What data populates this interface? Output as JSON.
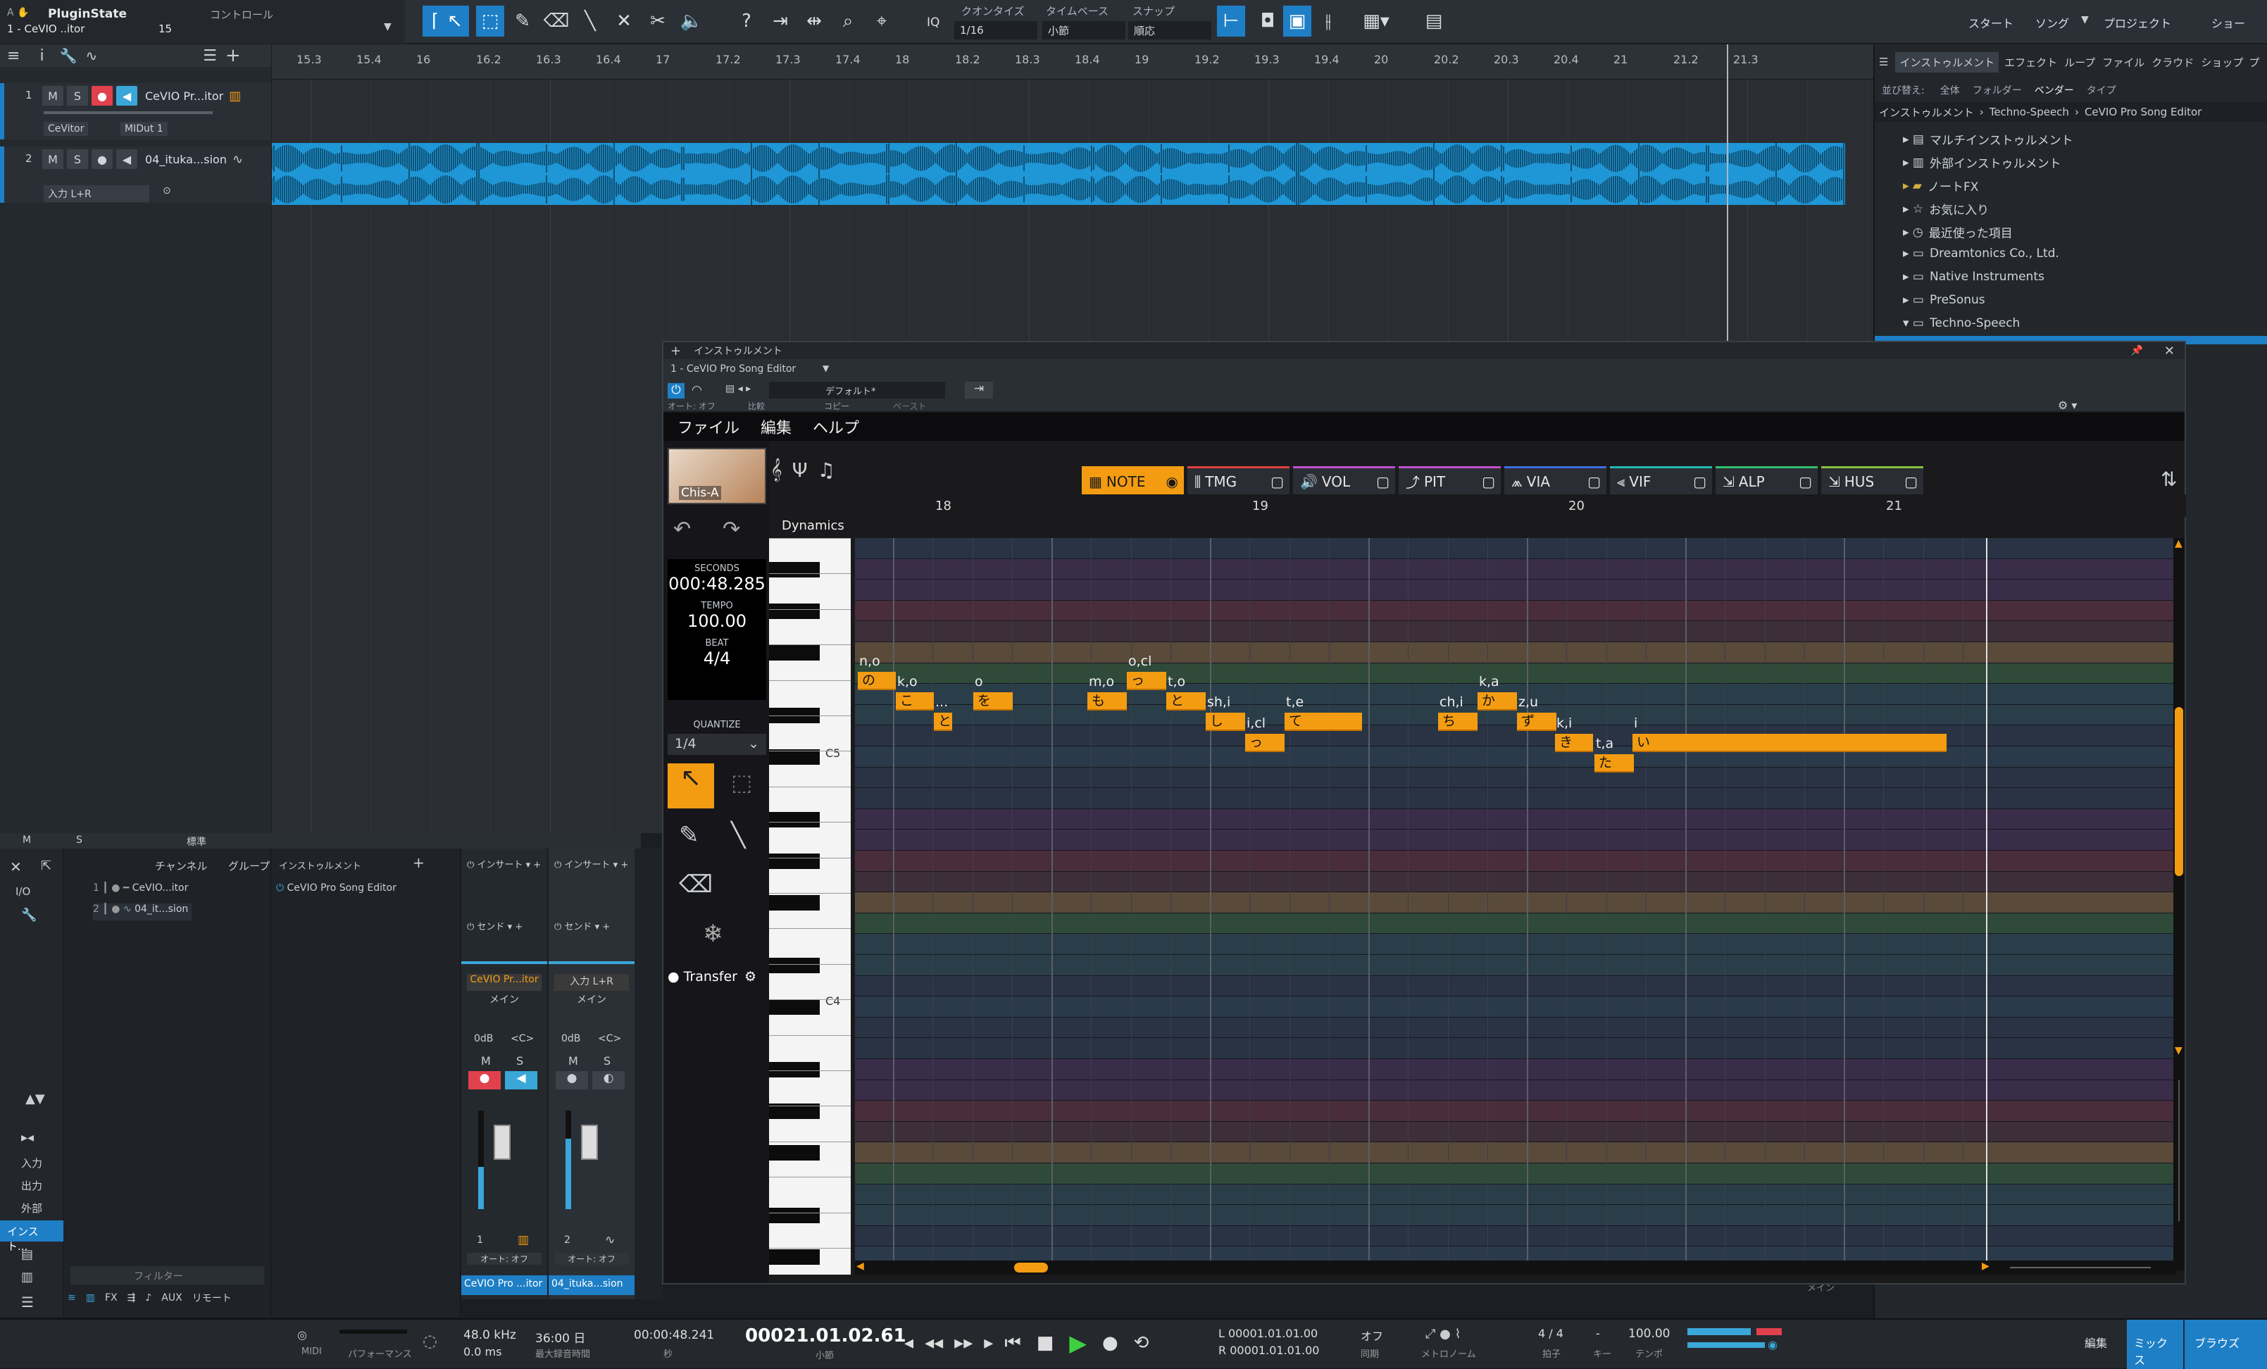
{
  "song": {
    "preset_top": "PluginState",
    "preset_bottom": "1 - CeVIO ..itor",
    "preset_num": "15",
    "control_label": "コントロール"
  },
  "toolbar": {
    "quantize_label": "クオンタイズ",
    "quantize_value": "1/16",
    "timebase_label": "タイムベース",
    "timebase_value": "小節",
    "snap_label": "スナップ",
    "snap_value": "順応",
    "iq": "IQ",
    "start": "スタート",
    "song": "ソング",
    "project": "プロジェクト",
    "show": "ショー"
  },
  "tracks": [
    {
      "num": "1",
      "name": "CeVIO Pr...itor",
      "in": "CeVitor",
      "out": "MIDut 1"
    },
    {
      "num": "2",
      "name": "04_ituka...sion",
      "in": "入力 L+R"
    }
  ],
  "ruler": [
    "15.3",
    "15.4",
    "16",
    "16.2",
    "16.3",
    "16.4",
    "17",
    "17.2",
    "17.3",
    "17.4",
    "18",
    "18.2",
    "18.3",
    "18.4",
    "19",
    "19.2",
    "19.3",
    "19.4",
    "20",
    "20.2",
    "20.3",
    "20.4",
    "21",
    "21.2",
    "21.3"
  ],
  "browser": {
    "tabs": [
      "インストゥルメント",
      "エフェクト",
      "ループ",
      "ファイル",
      "クラウド",
      "ショップ",
      "プ"
    ],
    "sort_label": "並び替え:",
    "sort_opts": [
      "全体",
      "フォルダー",
      "ベンダー",
      "タイプ"
    ],
    "breadcrumb": [
      "インストゥルメント",
      "Techno-Speech",
      "CeVIO Pro Song Editor"
    ],
    "items": [
      "マルチインストゥルメント",
      "外部インストゥルメント",
      "ノートFX",
      "お気に入り",
      "最近使った項目",
      "Dreamtonics Co., Ltd.",
      "Native Instruments",
      "PreSonus",
      "Techno-Speech"
    ]
  },
  "console": {
    "M": "M",
    "S": "S",
    "std": "標準",
    "channel": "チャンネル",
    "group": "グループ",
    "instrument": "インストゥルメント",
    "ch1": "CeVIO...itor",
    "ch2": "04_it...sion",
    "inst1": "CeVIO Pro Song Editor",
    "io": "I/O",
    "insert": "インサート",
    "send": "センド",
    "strip1_name": "CeVIO Pr...itor",
    "strip1_out": "メイン",
    "strip2_name": "入力 L+R",
    "strip2_out": "メイン",
    "db": "0dB",
    "pan": "<C>",
    "auto": "オート: オフ",
    "strip1_label": "CeVIO Pro ...itor",
    "strip2_label": "04_ituka...sion",
    "num1": "1",
    "num2": "2",
    "side": [
      "入力",
      "出力",
      "外部",
      "インスト..."
    ],
    "filter": "フィルター",
    "aux": "AUX",
    "remote": "リモート",
    "fx": "FX",
    "main": "メイン",
    "scale": [
      "10",
      "6",
      "0",
      "-6",
      "-12",
      "-18",
      "-24",
      "-30",
      "-48"
    ]
  },
  "editor": {
    "title": "インストゥルメント",
    "instance": "1 - CeVIO Pro Song Editor",
    "preset": "デフォルト*",
    "auto": "オート: オフ",
    "compare": "比較",
    "copy": "コピー",
    "paste": "ペースト",
    "menu": [
      "ファイル",
      "編集",
      "ヘルプ"
    ],
    "avatar": "Chis-A",
    "tabs": [
      "NOTE",
      "TMG",
      "VOL",
      "PIT",
      "VIA",
      "VIF",
      "ALP",
      "HUS"
    ],
    "tab_colors": [
      "#f39c12",
      "#e04040",
      "#c04fd0",
      "#c04fd0",
      "#3a6fe0",
      "#20b8b0",
      "#30c070",
      "#88c040"
    ],
    "bars": [
      "18",
      "19",
      "20",
      "21"
    ],
    "dynamics": "Dynamics",
    "seconds_label": "SECONDS",
    "seconds": "000:48.285",
    "tempo_label": "TEMPO",
    "tempo": "100.00",
    "beat_label": "BEAT",
    "beat": "4/4",
    "quantize_label": "QUANTIZE",
    "quantize": "1/4",
    "transfer": "Transfer",
    "c5": "C5",
    "c4": "C4",
    "notes": [
      {
        "ch": "の",
        "ph": "n,o"
      },
      {
        "ch": "こ",
        "ph": "k,o"
      },
      {
        "ch": "と",
        "ph": "..."
      },
      {
        "ch": "を",
        "ph": "o"
      },
      {
        "ch": "も",
        "ph": "m,o"
      },
      {
        "ch": "っ",
        "ph": "o,cl"
      },
      {
        "ch": "と",
        "ph": "t,o"
      },
      {
        "ch": "し",
        "ph": "sh,i"
      },
      {
        "ch": "っ",
        "ph": "i,cl"
      },
      {
        "ch": "て",
        "ph": "t,e"
      },
      {
        "ch": "ち",
        "ph": "ch,i"
      },
      {
        "ch": "か",
        "ph": "k,a"
      },
      {
        "ch": "ず",
        "ph": "z,u"
      },
      {
        "ch": "き",
        "ph": "k,i"
      },
      {
        "ch": "た",
        "ph": "t,a"
      },
      {
        "ch": "い",
        "ph": "i"
      }
    ]
  },
  "transport": {
    "midi": "MIDI",
    "perf": "パフォーマンス",
    "rate": "48.0 kHz",
    "latency": "0.0 ms",
    "rec_time": "36:00 日",
    "rec_label": "最大録音時間",
    "sec": "00:00:48.241",
    "sec_label": "秒",
    "bars": "00021.01.02.61",
    "bars_label": "小節",
    "L": "00001.01.01.00",
    "R": "00001.01.01.00",
    "off": "オフ",
    "sync": "同期",
    "metro": "メトロノーム",
    "sig": "4 / 4",
    "sig_label": "拍子",
    "key": "-",
    "key_label": "キー",
    "tempo": "100.00",
    "tempo_label": "テンポ",
    "edit": "編集",
    "mix": "ミックス",
    "browse": "ブラウズ"
  }
}
